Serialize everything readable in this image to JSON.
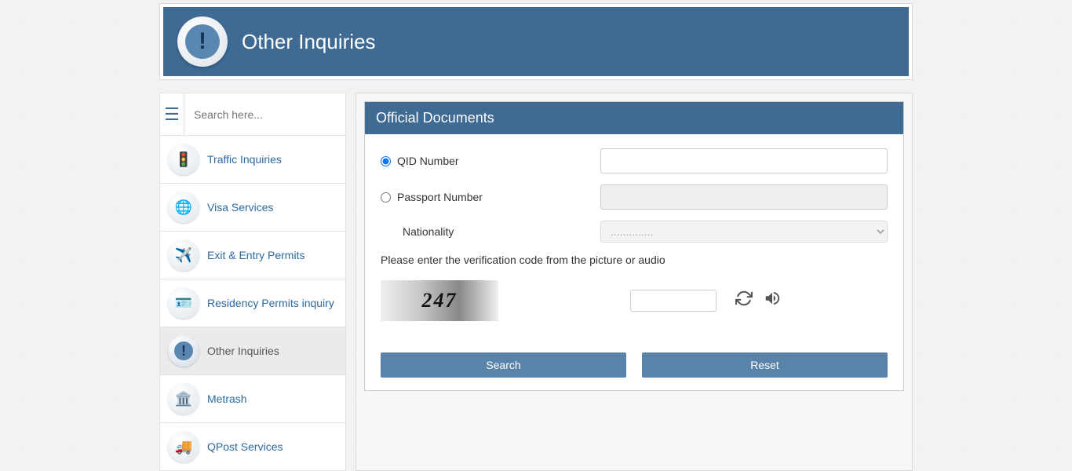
{
  "header": {
    "title": "Other Inquiries"
  },
  "sidebar": {
    "search_placeholder": "Search here...",
    "items": [
      {
        "label": "Traffic Inquiries",
        "icon": "traffic"
      },
      {
        "label": "Visa Services",
        "icon": "visa"
      },
      {
        "label": "Exit & Entry Permits",
        "icon": "exit"
      },
      {
        "label": "Residency Permits inquiry",
        "icon": "residency"
      },
      {
        "label": "Other Inquiries",
        "icon": "other",
        "active": true
      },
      {
        "label": "Metrash",
        "icon": "metrash"
      },
      {
        "label": "QPost Services",
        "icon": "qpost"
      }
    ]
  },
  "panel": {
    "title": "Official Documents",
    "option_qid": "QID Number",
    "option_passport": "Passport Number",
    "label_nationality": "Nationality",
    "nationality_placeholder": "..............",
    "verification_hint": "Please enter the verification code from the picture or audio",
    "captcha_value": "247",
    "btn_search": "Search",
    "btn_reset": "Reset"
  }
}
